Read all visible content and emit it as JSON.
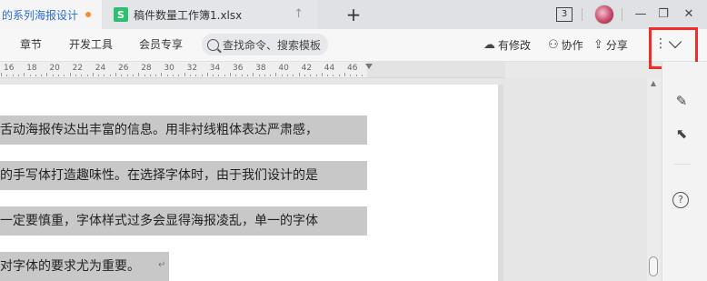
{
  "tabs": [
    {
      "label": "的系列海报设计",
      "modified": true,
      "active": true
    },
    {
      "label": "稿件数量工作簿1.xlsx",
      "icon": "S",
      "icon_color": "#2fbf71"
    }
  ],
  "window": {
    "count_badge": "3",
    "minimize": "—",
    "restore": "❐",
    "close": "✕"
  },
  "ribbon": {
    "menu": [
      "章节",
      "开发工具",
      "会员专享"
    ],
    "search_placeholder": "查找命令、搜索模板",
    "right": {
      "modified": "有修改",
      "collab": "协作",
      "share": "分享"
    }
  },
  "ruler": {
    "labels": [
      "16",
      "18",
      "20",
      "22",
      "24",
      "26",
      "28",
      "30",
      "32",
      "34",
      "36",
      "38",
      "40",
      "42",
      "44",
      "46"
    ]
  },
  "document": {
    "lines": [
      "舌动海报传达出丰富的信息。用非衬线粗体表达严肃感，",
      "的手写体打造趣味性。在选择字体时，由于我们设计的是",
      "一定要慎重，字体样式过多会显得海报凌乱，单一的字体",
      "对字体的要求尤为重要。"
    ],
    "selection_color": "#c8c8c8"
  },
  "colors": {
    "accent": "#2b6bd6",
    "highlight_box": "#f02c2c",
    "modified_dot": "#f08c3a"
  }
}
